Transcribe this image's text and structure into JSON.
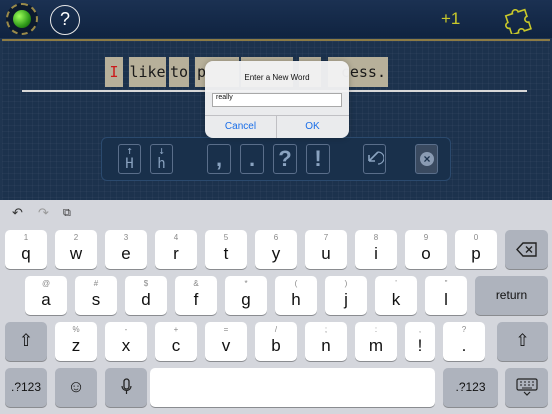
{
  "topbar": {
    "help_label": "?",
    "score": "+1"
  },
  "sentence": {
    "tiles": [
      "I",
      "like",
      "to",
      "p",
      "",
      "",
      "cess."
    ]
  },
  "tools": {
    "upper_letter": "H",
    "upper_arrow": "↑",
    "lower_letter": "h",
    "lower_arrow": "↓",
    "comma": ",",
    "period": ".",
    "question": "?",
    "exclaim": "!"
  },
  "dialog": {
    "title": "Enter a New Word",
    "input_value": "really",
    "cancel": "Cancel",
    "ok": "OK"
  },
  "keyboard": {
    "row1": [
      {
        "main": "q",
        "alt": "1"
      },
      {
        "main": "w",
        "alt": "2"
      },
      {
        "main": "e",
        "alt": "3"
      },
      {
        "main": "r",
        "alt": "4"
      },
      {
        "main": "t",
        "alt": "5"
      },
      {
        "main": "y",
        "alt": "6"
      },
      {
        "main": "u",
        "alt": "7"
      },
      {
        "main": "i",
        "alt": "8"
      },
      {
        "main": "o",
        "alt": "9"
      },
      {
        "main": "p",
        "alt": "0"
      }
    ],
    "row2": [
      {
        "main": "a",
        "alt": "@"
      },
      {
        "main": "s",
        "alt": "#"
      },
      {
        "main": "d",
        "alt": "$"
      },
      {
        "main": "f",
        "alt": "&"
      },
      {
        "main": "g",
        "alt": "*"
      },
      {
        "main": "h",
        "alt": "("
      },
      {
        "main": "j",
        "alt": ")"
      },
      {
        "main": "k",
        "alt": "’"
      },
      {
        "main": "l",
        "alt": "\""
      }
    ],
    "row3": [
      {
        "main": "z",
        "alt": "%"
      },
      {
        "main": "x",
        "alt": "-"
      },
      {
        "main": "c",
        "alt": "+"
      },
      {
        "main": "v",
        "alt": "="
      },
      {
        "main": "b",
        "alt": "/"
      },
      {
        "main": "n",
        "alt": ";"
      },
      {
        "main": "m",
        "alt": ":"
      },
      {
        "main": "!",
        "alt": ","
      },
      {
        "main": ".",
        "alt": "?"
      }
    ],
    "return_label": "return",
    "numbers_label": ".?123",
    "icons": {
      "undo": "undo-icon",
      "redo": "redo-icon",
      "paste": "paste-icon",
      "backspace": "backspace-icon",
      "shift": "shift-icon",
      "emoji": "emoji-icon",
      "mic": "microphone-icon",
      "dismiss": "keyboard-dismiss-icon"
    }
  }
}
